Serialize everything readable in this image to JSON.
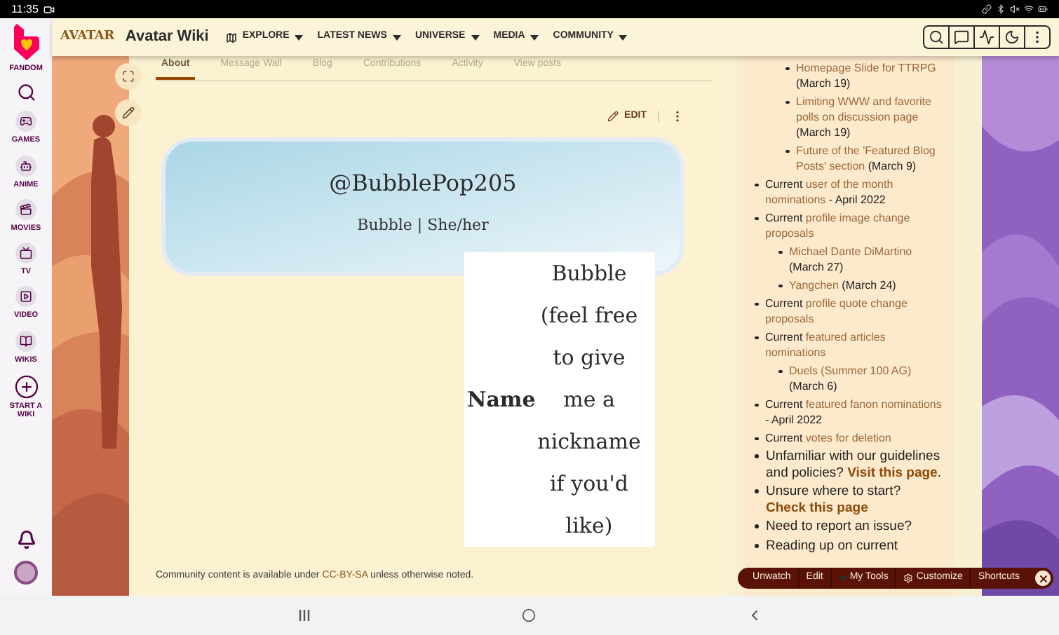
{
  "status_bar": {
    "time": "11:35"
  },
  "fandom_sidebar": {
    "brand": "FANDOM",
    "items": [
      {
        "kind": "games",
        "label": "GAMES"
      },
      {
        "kind": "anime",
        "label": "ANIME"
      },
      {
        "kind": "movies",
        "label": "MOVIES"
      },
      {
        "kind": "tv",
        "label": "TV"
      },
      {
        "kind": "video",
        "label": "VIDEO"
      },
      {
        "kind": "wikis",
        "label": "WIKIS"
      },
      {
        "kind": "start",
        "label": "START A WIKI"
      }
    ]
  },
  "header": {
    "logo": "AVATAR",
    "wiki_name": "Avatar Wiki",
    "nav": [
      {
        "label": "EXPLORE",
        "kind": "explore"
      },
      {
        "label": "LATEST NEWS",
        "kind": "plain"
      },
      {
        "label": "UNIVERSE",
        "kind": "plain"
      },
      {
        "label": "MEDIA",
        "kind": "plain"
      },
      {
        "label": "COMMUNITY",
        "kind": "plain"
      }
    ]
  },
  "profile_tabs": [
    {
      "label": "About",
      "selected": true
    },
    {
      "label": "Message Wall",
      "selected": false
    },
    {
      "label": "Blog",
      "selected": false
    },
    {
      "label": "Contributions",
      "selected": false
    },
    {
      "label": "Activity",
      "selected": false
    },
    {
      "label": "View posts",
      "selected": false
    }
  ],
  "page_actions": {
    "edit": "EDIT"
  },
  "profile_card": {
    "username": "@BubblePop205",
    "subtitle": "Bubble | She/her"
  },
  "info_table": {
    "rows": [
      {
        "label": "Name",
        "value": "Bubble (feel free to give me a nickname if you'd like)"
      }
    ]
  },
  "footer": {
    "text": "Community content is available under",
    "link": "CC-BY-SA",
    "suffix": "unless otherwise noted."
  },
  "sidebar_list": [
    {
      "kind": "group",
      "children": [
        {
          "kind": "entry",
          "link": "Homepage Slide for TTRPG",
          "suffix": "(March 19)"
        },
        {
          "kind": "entry",
          "link": "Limiting WWW and favorite polls on discussion page",
          "suffix": "(March 19)"
        },
        {
          "kind": "entry",
          "link": "Future of the 'Featured Blog Posts' section",
          "suffix": "(March 9)"
        }
      ]
    },
    {
      "kind": "entry",
      "prefix": "Current",
      "link": "user of the month nominations",
      "suffix": "- April 2022"
    },
    {
      "kind": "entry",
      "prefix": "Current",
      "link": "profile image change proposals",
      "children": [
        {
          "kind": "entry",
          "link": "Michael Dante DiMartino",
          "suffix": "(March 27)"
        },
        {
          "kind": "entry",
          "link": "Yangchen",
          "suffix": "(March 24)"
        }
      ]
    },
    {
      "kind": "entry",
      "prefix": "Current",
      "link": "profile quote change proposals"
    },
    {
      "kind": "entry",
      "prefix": "Current",
      "link": "featured articles nominations",
      "children": [
        {
          "kind": "entry",
          "link": "Duels (Summer 100 AG)",
          "suffix": "(March 6)"
        }
      ]
    },
    {
      "kind": "entry",
      "prefix": "Current",
      "link": "featured fanon nominations",
      "suffix": "- April 2022"
    },
    {
      "kind": "entry",
      "prefix": "Current",
      "link": "votes for deletion"
    },
    {
      "kind": "help",
      "prefix": "Unfamiliar with our guidelines and policies?",
      "link": "Visit this page",
      "suffix": "."
    },
    {
      "kind": "help",
      "prefix": "Unsure where to start?",
      "link": "Check this page"
    },
    {
      "kind": "help",
      "prefix": "Need to report an issue?"
    },
    {
      "kind": "help",
      "prefix": "Reading up on current"
    }
  ],
  "toolbar": {
    "items": [
      {
        "label": "Unwatch",
        "kind": "plain"
      },
      {
        "label": "Edit",
        "kind": "plain"
      },
      {
        "label": "My Tools",
        "kind": "menu"
      },
      {
        "label": "Customize",
        "kind": "gear"
      },
      {
        "label": "Shortcuts",
        "kind": "plain"
      }
    ]
  }
}
